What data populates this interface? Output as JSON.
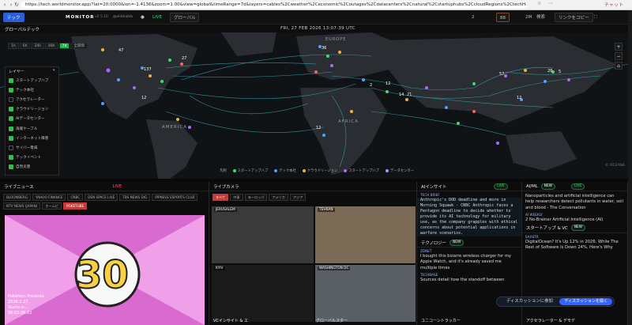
{
  "browser": {
    "url": "https://tech.worldmonitor.app/?lat=20.0000&lon=-1.4136&zoom=1.00&view=global&timeRange=7d&layers=cables%2Cweather%2Ceconomic%2Coutages%2Cdatacenters%2Cnatural%2Cstartuphubs%2CcloudRegions%2CtechHQs%2Cte...",
    "user": "チャット"
  },
  "appbar": {
    "tab_tech": "テック",
    "brand": "MONITOR",
    "version": "v2.5.10",
    "handle": "@eliehabib",
    "live": "LIVE",
    "region": "グローバル",
    "count": "2",
    "counter_badge": "88",
    "ratio": "2M",
    "search": "検索",
    "copy_link": "リンクをコピー"
  },
  "map": {
    "header_left": "グローバルテック",
    "timestamp": "FRI, 27 FEB 2026 13:07:39 UTC",
    "time_buttons": [
      "1h",
      "6h",
      "24h",
      "48h",
      "7d",
      "全期間"
    ],
    "continents": {
      "europe": "EUROPE",
      "africa": "AFRICA",
      "america": "AMERICA"
    },
    "labels": [
      "137",
      "36",
      "47",
      "27",
      "12",
      "2",
      "12",
      "14",
      "21",
      "57",
      "28",
      "5",
      "12",
      "12"
    ],
    "watermark": "© OCEANA",
    "zoom_in": "+",
    "zoom_out": "−",
    "layers_title": "レイヤー"
  },
  "layers": [
    {
      "label": "スタートアップハブ",
      "on": true
    },
    {
      "label": "テック本社",
      "on": true
    },
    {
      "label": "アクセラレーター",
      "on": false
    },
    {
      "label": "クラウドリージョン",
      "on": true
    },
    {
      "label": "AIデータセンター",
      "on": true
    },
    {
      "label": "海底ケーブル",
      "on": true
    },
    {
      "label": "インターネット障害",
      "on": true
    },
    {
      "label": "サイバー脅威",
      "on": false
    },
    {
      "label": "テックイベント",
      "on": true
    },
    {
      "label": "自然災害",
      "on": true
    }
  ],
  "legend": {
    "title": "凡例",
    "items": [
      {
        "label": "スタートアップハブ",
        "color": "#3ddc68"
      },
      {
        "label": "テック本社",
        "color": "#4aa3ff"
      },
      {
        "label": "クラウドリージョン",
        "color": "#f0b040"
      },
      {
        "label": "スタートアップハブ",
        "color": "#b066ff"
      },
      {
        "label": "データセンター",
        "color": "#9a9aff"
      }
    ]
  },
  "panels": {
    "live_news": {
      "title": "ライブニュース",
      "live": "LIVE",
      "channels": [
        "BLOOMBERG",
        "YAHOO FINANCE",
        "CNBC",
        "DEN SPACE LIVE",
        "TBS NEWS DIG",
        "IPPNESS ESPORTS CLUB",
        "NTV NEWS (JAPAN)",
        "ホームピ",
        "POKETUBE"
      ],
      "card_title": "Pokémon Presents",
      "card_date": "2026.2.27",
      "card_starts": "Starts in...",
      "card_time": "00:02:36:02"
    },
    "live_cams": {
      "title": "ライブカメラ",
      "filters": [
        "すべて",
        "中東",
        "ヨーロッパ",
        "アメリカ",
        "アジア"
      ],
      "cams": [
        "JERUSALEM",
        "TEHRAN",
        "KYIV",
        "WASHINGTON DC"
      ]
    },
    "ai_insight": {
      "title": "AIインサイト",
      "live": "LIVE",
      "tag": "TECH BRIEF",
      "brief": "Anthropic's DOD deadline and more in Morning Squawk - CNBC Anthropic faces a Pentagon deadline to decide whether to provide its AI technology for military use, as the company grapples with ethical concerns about potential applications in warfare scenarios.",
      "tech_title": "テクノロジー",
      "tech_badge": "NEW",
      "tech_story": "I bought this bizarre wireless charger for my Apple Watch, and it's already saved me multiple times",
      "tech_source": "ZDNET",
      "sub_label": "TECHBASE",
      "sub_story": "Sources detail how the standoff between",
      "bottom_title": "ユニコーントラッカー"
    },
    "ai_ml": {
      "title": "AI/ML",
      "badge": "NEW",
      "live": "LIVE",
      "item1": "Nanoparticles and artificial intelligence can help researchers detect pollutants in water, soil and blood - The Conversation",
      "item1_meta": "AI WEEKLY",
      "item2": "2 No-Brainer Artificial Intelligence (AI)",
      "startup_title": "スタートアップ & VC",
      "startup_badge": "NEW",
      "startup_story": "DigitalOcean? It's Up 12% in 2026. While The Rest of Software Is Down 24%. Here's Why",
      "startup_meta": "SAASTR"
    },
    "misc": {
      "vc_insight": "VCインサイト & エ",
      "global_startups": "グローバルスター",
      "accel": "アクセラレーター & デモデ"
    }
  },
  "discuss": {
    "text": "ディスカッションに参加",
    "button": "ディスカッションを開く"
  }
}
